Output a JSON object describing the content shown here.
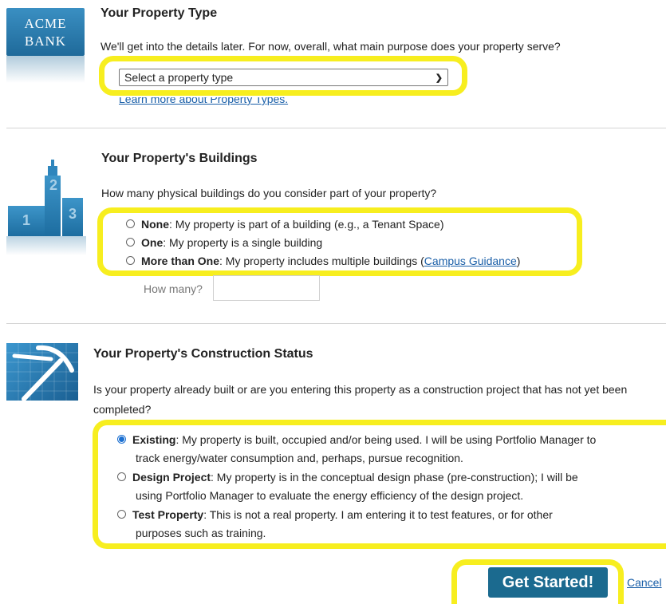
{
  "section1": {
    "logo_line1": "ACME",
    "logo_line2": "BANK",
    "title": "Your Property Type",
    "description": "We'll get into the details later. For now, overall, what main purpose does your property serve?",
    "select_value": "Select a property type",
    "learn_more": "Learn more about Property Types."
  },
  "section2": {
    "title": "Your Property's Buildings",
    "question": "How many physical buildings do you consider part of your property?",
    "options": [
      {
        "label": "None",
        "text": ": My property is part of a building (e.g., a Tenant Space)"
      },
      {
        "label": "One",
        "text": ": My property is a single building"
      },
      {
        "label": "More than One",
        "text": ": My property includes multiple buildings (",
        "link": "Campus Guidance",
        "suffix": ")"
      }
    ],
    "how_many_label": "How many?",
    "building_numbers": [
      "1",
      "2",
      "3"
    ]
  },
  "section3": {
    "title": "Your Property's Construction Status",
    "question": "Is your property already built or are you entering this property as a construction project that has not yet been completed?",
    "options": [
      {
        "label": "Existing",
        "line1": ": My property is built, occupied and/or being used. I will be using Portfolio Manager to",
        "line2": "track energy/water consumption and, perhaps, pursue recognition."
      },
      {
        "label": "Design Project",
        "line1": ": My property is in the conceptual design phase (pre-construction); I will be",
        "line2": "using Portfolio Manager to evaluate the energy efficiency of the design project."
      },
      {
        "label": "Test Property",
        "line1": ": This is not a real property. I am entering it to test features, or for other",
        "line2": "purposes such as training."
      }
    ]
  },
  "actions": {
    "get_started": "Get Started!",
    "cancel": "Cancel"
  },
  "colors": {
    "highlight": "#f7ee1f",
    "button": "#1b6a8f",
    "link": "#1a5fa8",
    "icon_blue": "#1f7fb3"
  }
}
